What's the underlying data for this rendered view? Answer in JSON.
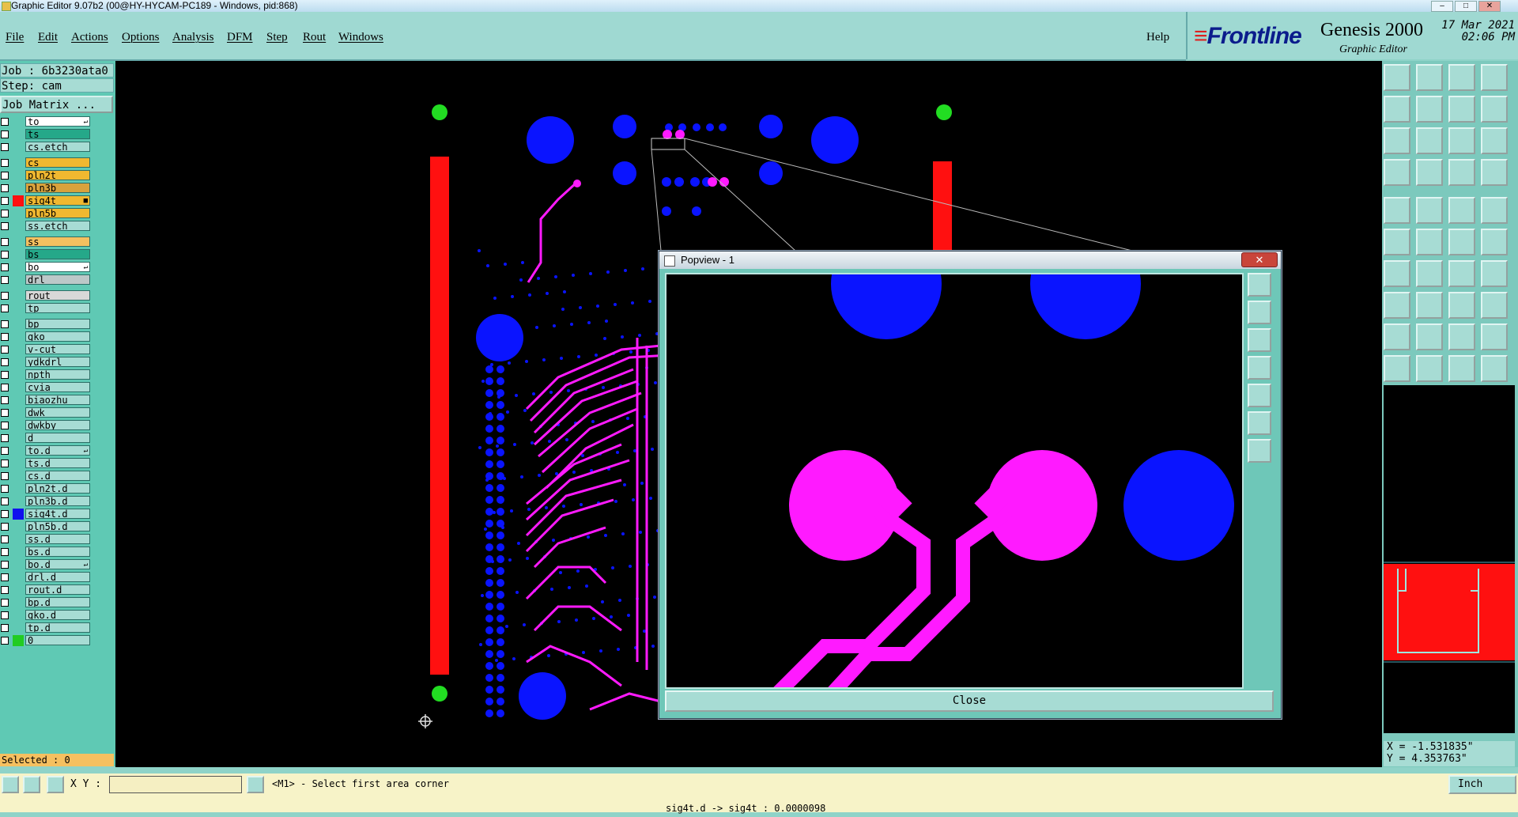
{
  "window": {
    "title": "Graphic Editor 9.07b2 (00@HY-HYCAM-PC189 - Windows, pid:868)"
  },
  "menu": {
    "items": [
      "File",
      "Edit",
      "Actions",
      "Options",
      "Analysis",
      "DFM",
      "Step",
      "Rout",
      "Windows"
    ],
    "help": "Help"
  },
  "brand": {
    "logo": "Frontline",
    "product": "Genesis 2000",
    "subtitle": "Graphic Editor",
    "date": "17 Mar 2021",
    "time": "02:06 PM"
  },
  "job": {
    "job_label": "Job : 6b3230ata0",
    "step_label": "Step: cam",
    "matrix_button": "Job Matrix ..."
  },
  "layers": [
    {
      "name": "to",
      "bg": "#ffffff",
      "swatch": "",
      "mark": "↵"
    },
    {
      "name": "ts",
      "bg": "#25a889",
      "swatch": ""
    },
    {
      "name": "cs.etch",
      "bg": "#a7dcd4",
      "swatch": ""
    },
    {
      "name": "cs",
      "bg": "#f0b830",
      "swatch": ""
    },
    {
      "name": "pln2t",
      "bg": "#f0b830",
      "swatch": ""
    },
    {
      "name": "pln3b",
      "bg": "#d9a23c",
      "swatch": ""
    },
    {
      "name": "sig4t",
      "bg": "#f0b830",
      "swatch": "#ff1010",
      "mark": "■"
    },
    {
      "name": "pln5b",
      "bg": "#f0b830",
      "swatch": ""
    },
    {
      "name": "ss.etch",
      "bg": "#a7dcd4",
      "swatch": ""
    },
    {
      "name": "ss",
      "bg": "#f5c060",
      "swatch": ""
    },
    {
      "name": "bs",
      "bg": "#25a889",
      "swatch": ""
    },
    {
      "name": "bo",
      "bg": "#ffffff",
      "swatch": "",
      "mark": "↵"
    },
    {
      "name": "drl",
      "bg": "#bcc8c8",
      "swatch": ""
    },
    {
      "name": "rout",
      "bg": "#d8d8d8",
      "swatch": ""
    },
    {
      "name": "tp",
      "bg": "#a7dcd4",
      "swatch": ""
    },
    {
      "name": "bp",
      "bg": "#a7dcd4",
      "swatch": ""
    },
    {
      "name": "gko",
      "bg": "#a7dcd4",
      "swatch": ""
    },
    {
      "name": "v-cut",
      "bg": "#a7dcd4",
      "swatch": ""
    },
    {
      "name": "ydkdrl",
      "bg": "#a7dcd4",
      "swatch": ""
    },
    {
      "name": "npth",
      "bg": "#a7dcd4",
      "swatch": ""
    },
    {
      "name": "cvia",
      "bg": "#a7dcd4",
      "swatch": ""
    },
    {
      "name": "biaozhu",
      "bg": "#a7dcd4",
      "swatch": ""
    },
    {
      "name": "dwk",
      "bg": "#a7dcd4",
      "swatch": ""
    },
    {
      "name": "dwkby",
      "bg": "#a7dcd4",
      "swatch": ""
    },
    {
      "name": "d",
      "bg": "#a7dcd4",
      "swatch": ""
    },
    {
      "name": "to.d",
      "bg": "#a7dcd4",
      "swatch": "",
      "mark": "↵"
    },
    {
      "name": "ts.d",
      "bg": "#a7dcd4",
      "swatch": ""
    },
    {
      "name": "cs.d",
      "bg": "#a7dcd4",
      "swatch": ""
    },
    {
      "name": "pln2t.d",
      "bg": "#a7dcd4",
      "swatch": ""
    },
    {
      "name": "pln3b.d",
      "bg": "#a7dcd4",
      "swatch": ""
    },
    {
      "name": "sig4t.d",
      "bg": "#a7dcd4",
      "swatch": "#1010ee"
    },
    {
      "name": "pln5b.d",
      "bg": "#a7dcd4",
      "swatch": ""
    },
    {
      "name": "ss.d",
      "bg": "#a7dcd4",
      "swatch": ""
    },
    {
      "name": "bs.d",
      "bg": "#a7dcd4",
      "swatch": ""
    },
    {
      "name": "bo.d",
      "bg": "#a7dcd4",
      "swatch": "",
      "mark": "↵"
    },
    {
      "name": "drl.d",
      "bg": "#a7dcd4",
      "swatch": ""
    },
    {
      "name": "rout.d",
      "bg": "#a7dcd4",
      "swatch": ""
    },
    {
      "name": "bp.d",
      "bg": "#a7dcd4",
      "swatch": ""
    },
    {
      "name": "gko.d",
      "bg": "#a7dcd4",
      "swatch": ""
    },
    {
      "name": "tp.d",
      "bg": "#a7dcd4",
      "swatch": ""
    },
    {
      "name": "0",
      "bg": "#a7dcd4",
      "swatch": "#22cc22"
    }
  ],
  "status": {
    "selected": "Selected : 0",
    "xy_label": "X Y :",
    "xy_value": "",
    "prompt": "<M1> - Select first area corner",
    "unit": "Inch",
    "bottom": "sig4t.d -> sig4t : 0.0000098"
  },
  "coords": {
    "x": "X = -1.531835\"",
    "y": "Y = 4.353763\""
  },
  "popview": {
    "title": "Popview - 1",
    "close_label": "Close"
  },
  "colors": {
    "accent": "#9fd9d2",
    "panel": "#5fc9b4",
    "canvas": "#000000",
    "layer_active": "#ff1010",
    "layer_drill": "#1010ee",
    "trace": "#ff1aff",
    "pad": "#0a14ff"
  }
}
